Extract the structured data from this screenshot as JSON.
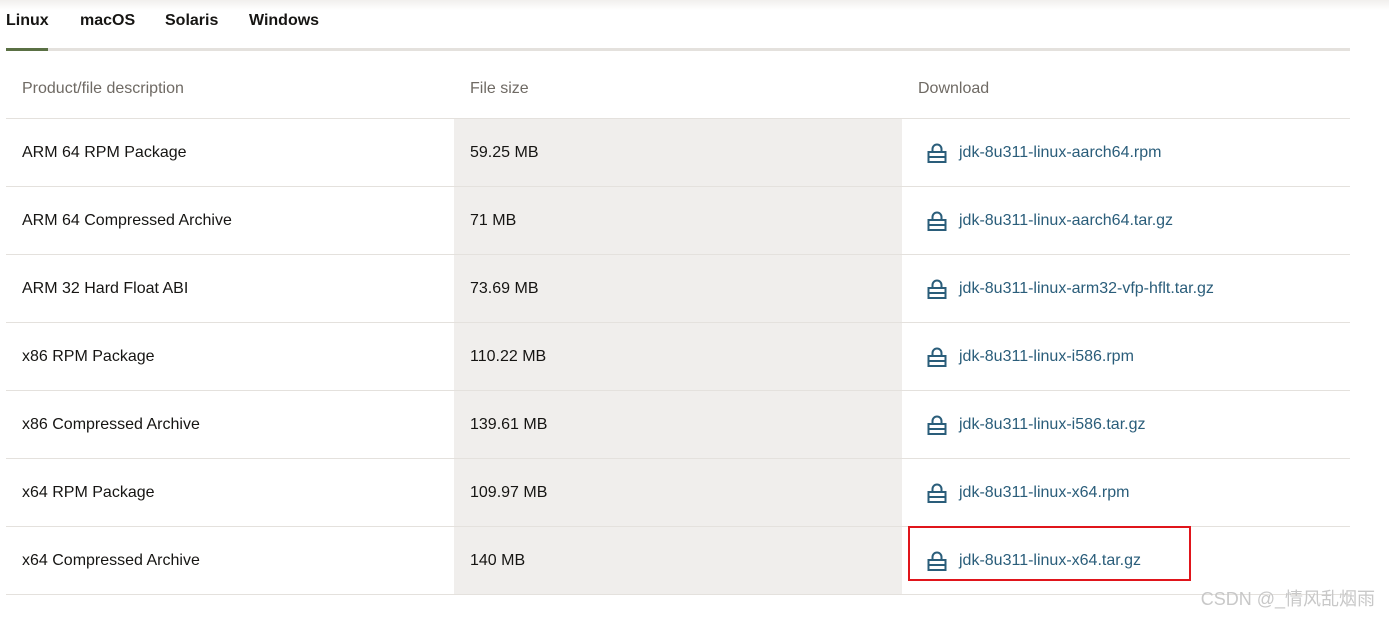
{
  "tabs": [
    {
      "label": "Linux",
      "active": true
    },
    {
      "label": "macOS",
      "active": false
    },
    {
      "label": "Solaris",
      "active": false
    },
    {
      "label": "Windows",
      "active": false
    }
  ],
  "table": {
    "headers": {
      "description": "Product/file description",
      "size": "File size",
      "download": "Download"
    },
    "rows": [
      {
        "description": "ARM 64 RPM Package",
        "size": "59.25 MB",
        "file": "jdk-8u311-linux-aarch64.rpm"
      },
      {
        "description": "ARM 64 Compressed Archive",
        "size": "71 MB",
        "file": "jdk-8u311-linux-aarch64.tar.gz"
      },
      {
        "description": "ARM 32 Hard Float ABI",
        "size": "73.69 MB",
        "file": "jdk-8u311-linux-arm32-vfp-hflt.tar.gz"
      },
      {
        "description": "x86 RPM Package",
        "size": "110.22 MB",
        "file": "jdk-8u311-linux-i586.rpm"
      },
      {
        "description": "x86 Compressed Archive",
        "size": "139.61 MB",
        "file": "jdk-8u311-linux-i586.tar.gz"
      },
      {
        "description": "x64 RPM Package",
        "size": "109.97 MB",
        "file": "jdk-8u311-linux-x64.rpm"
      },
      {
        "description": "x64 Compressed Archive",
        "size": "140 MB",
        "file": "jdk-8u311-linux-x64.tar.gz"
      }
    ]
  },
  "icons": {
    "download": "lock-icon"
  },
  "colors": {
    "link": "#2a5d7a",
    "active_tab_underline": "#5a7044",
    "highlight_box": "#e0151b",
    "size_column_bg": "#f0eeec"
  },
  "watermark": "CSDN @_情风乱烟雨"
}
